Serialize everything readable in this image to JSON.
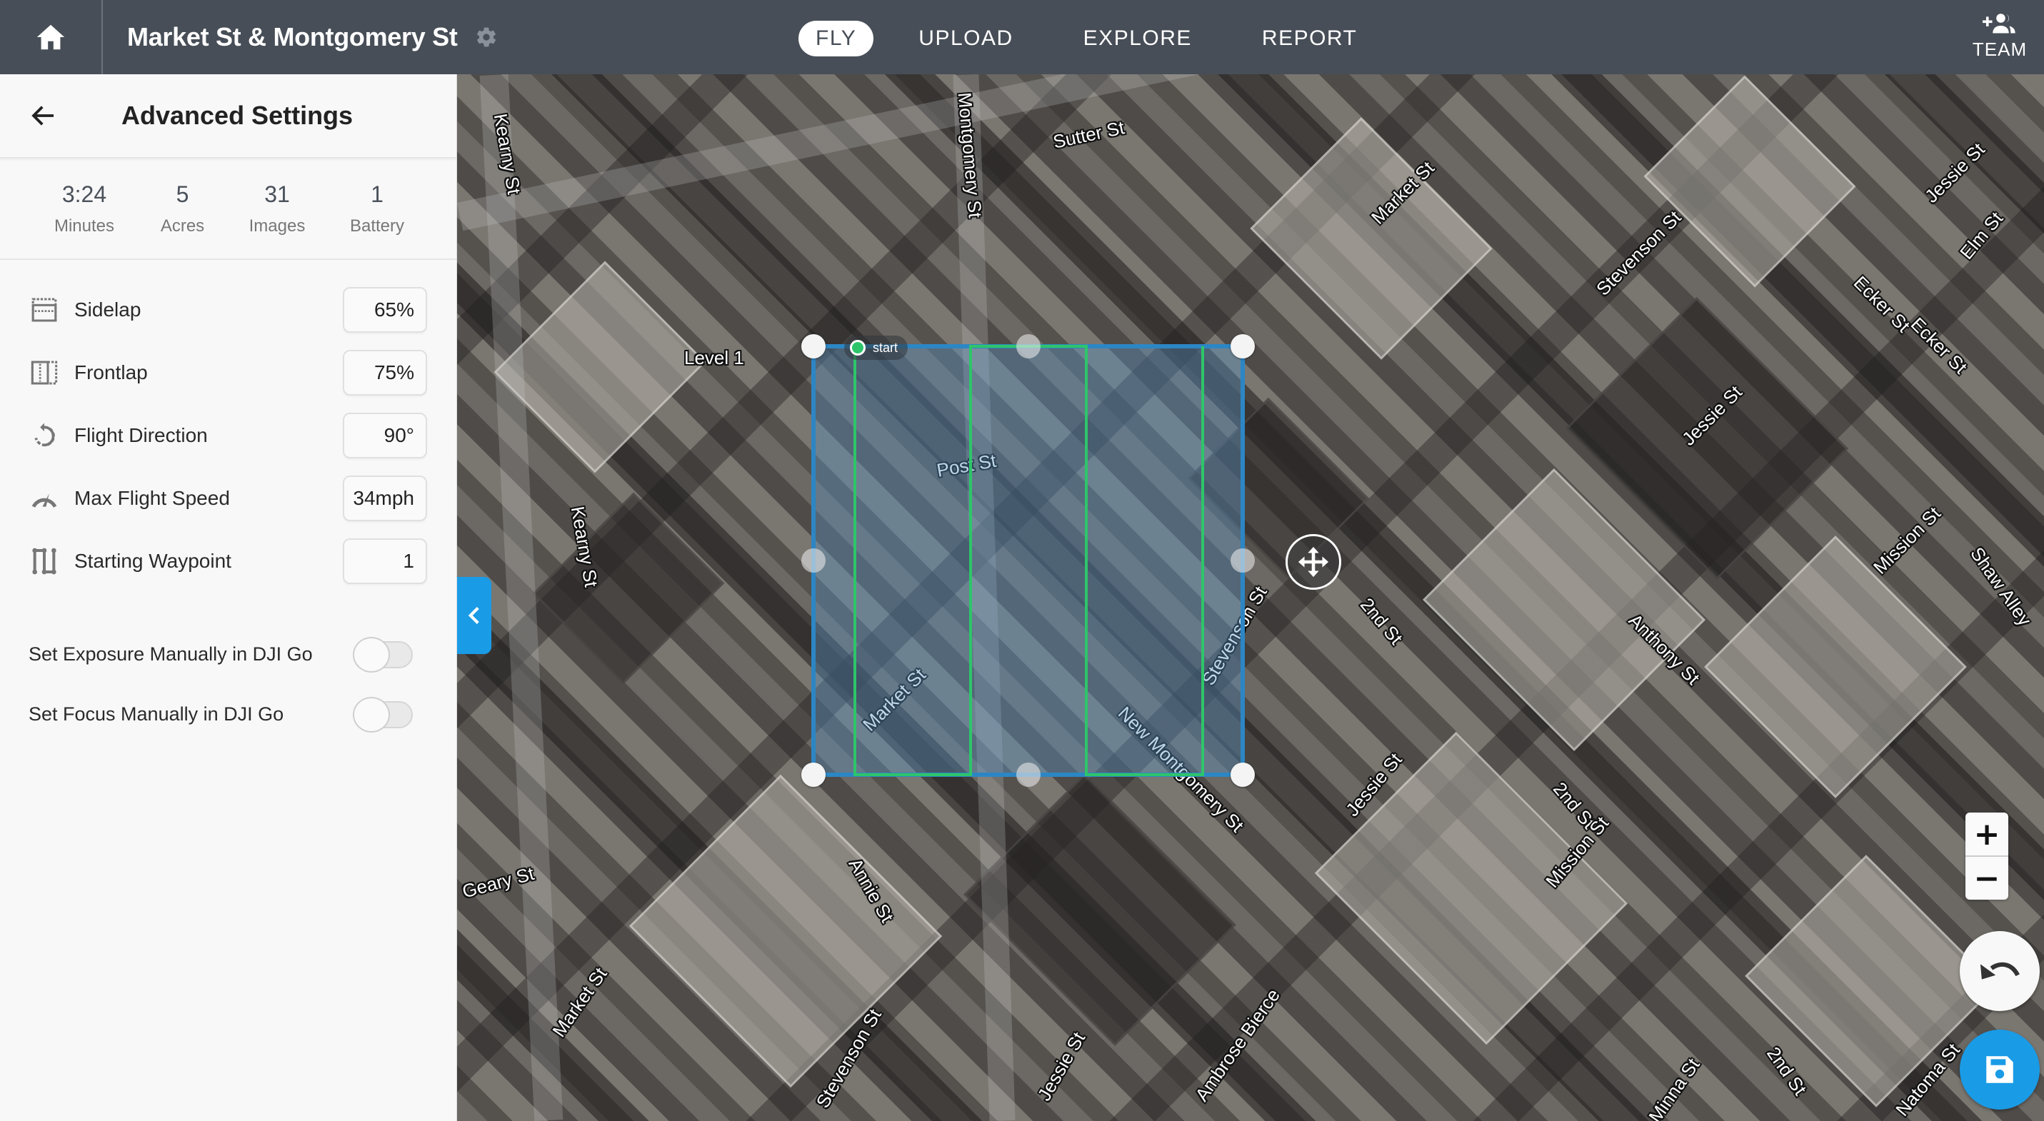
{
  "header": {
    "title": "Market St & Montgomery St",
    "nav_tabs": [
      {
        "label": "FLY",
        "active": true
      },
      {
        "label": "UPLOAD",
        "active": false
      },
      {
        "label": "EXPLORE",
        "active": false
      },
      {
        "label": "REPORT",
        "active": false
      }
    ],
    "team_label": "TEAM"
  },
  "sidebar": {
    "title": "Advanced Settings",
    "stats": [
      {
        "value": "3:24",
        "label": "Minutes"
      },
      {
        "value": "5",
        "label": "Acres"
      },
      {
        "value": "31",
        "label": "Images"
      },
      {
        "value": "1",
        "label": "Battery"
      }
    ],
    "settings": [
      {
        "icon": "sidelap-icon",
        "label": "Sidelap",
        "value": "65%"
      },
      {
        "icon": "frontlap-icon",
        "label": "Frontlap",
        "value": "75%"
      },
      {
        "icon": "rotate-icon",
        "label": "Flight Direction",
        "value": "90°"
      },
      {
        "icon": "speedometer-icon",
        "label": "Max Flight Speed",
        "value": "34mph"
      },
      {
        "icon": "waypoint-path-icon",
        "label": "Starting Waypoint",
        "value": "1"
      }
    ],
    "toggles": [
      {
        "label": "Set Exposure Manually in DJI Go",
        "on": false
      },
      {
        "label": "Set Focus Manually in DJI Go",
        "on": false
      }
    ]
  },
  "map": {
    "start_label": "start",
    "polygon_level_label": "Level 1",
    "flight_lines": 4,
    "colors": {
      "accent": "#1a9be6",
      "polygon_border": "#2d86c4",
      "flight_path": "#2ec56a",
      "header_bg": "#474e57"
    },
    "street_labels": [
      "Kearny St",
      "Montgomery St",
      "Sutter St",
      "Market St",
      "Level 1",
      "Post St",
      "Kearny St",
      "Market St",
      "New Montgomery St",
      "Stevenson St",
      "2nd St",
      "Stevenson St",
      "Jessie St",
      "Ecker St",
      "Ecker St",
      "Jessie St",
      "Elm St",
      "Mission St",
      "Shaw Alley",
      "Anthony St",
      "Geary St",
      "Annie St",
      "Market St",
      "Jessie St",
      "2nd St",
      "Mission St",
      "Stevenson St",
      "Jessie St",
      "Ambrose Bierce",
      "Minna St",
      "2nd St",
      "Natoma St"
    ],
    "zoom_in_label": "+",
    "zoom_out_label": "−"
  }
}
